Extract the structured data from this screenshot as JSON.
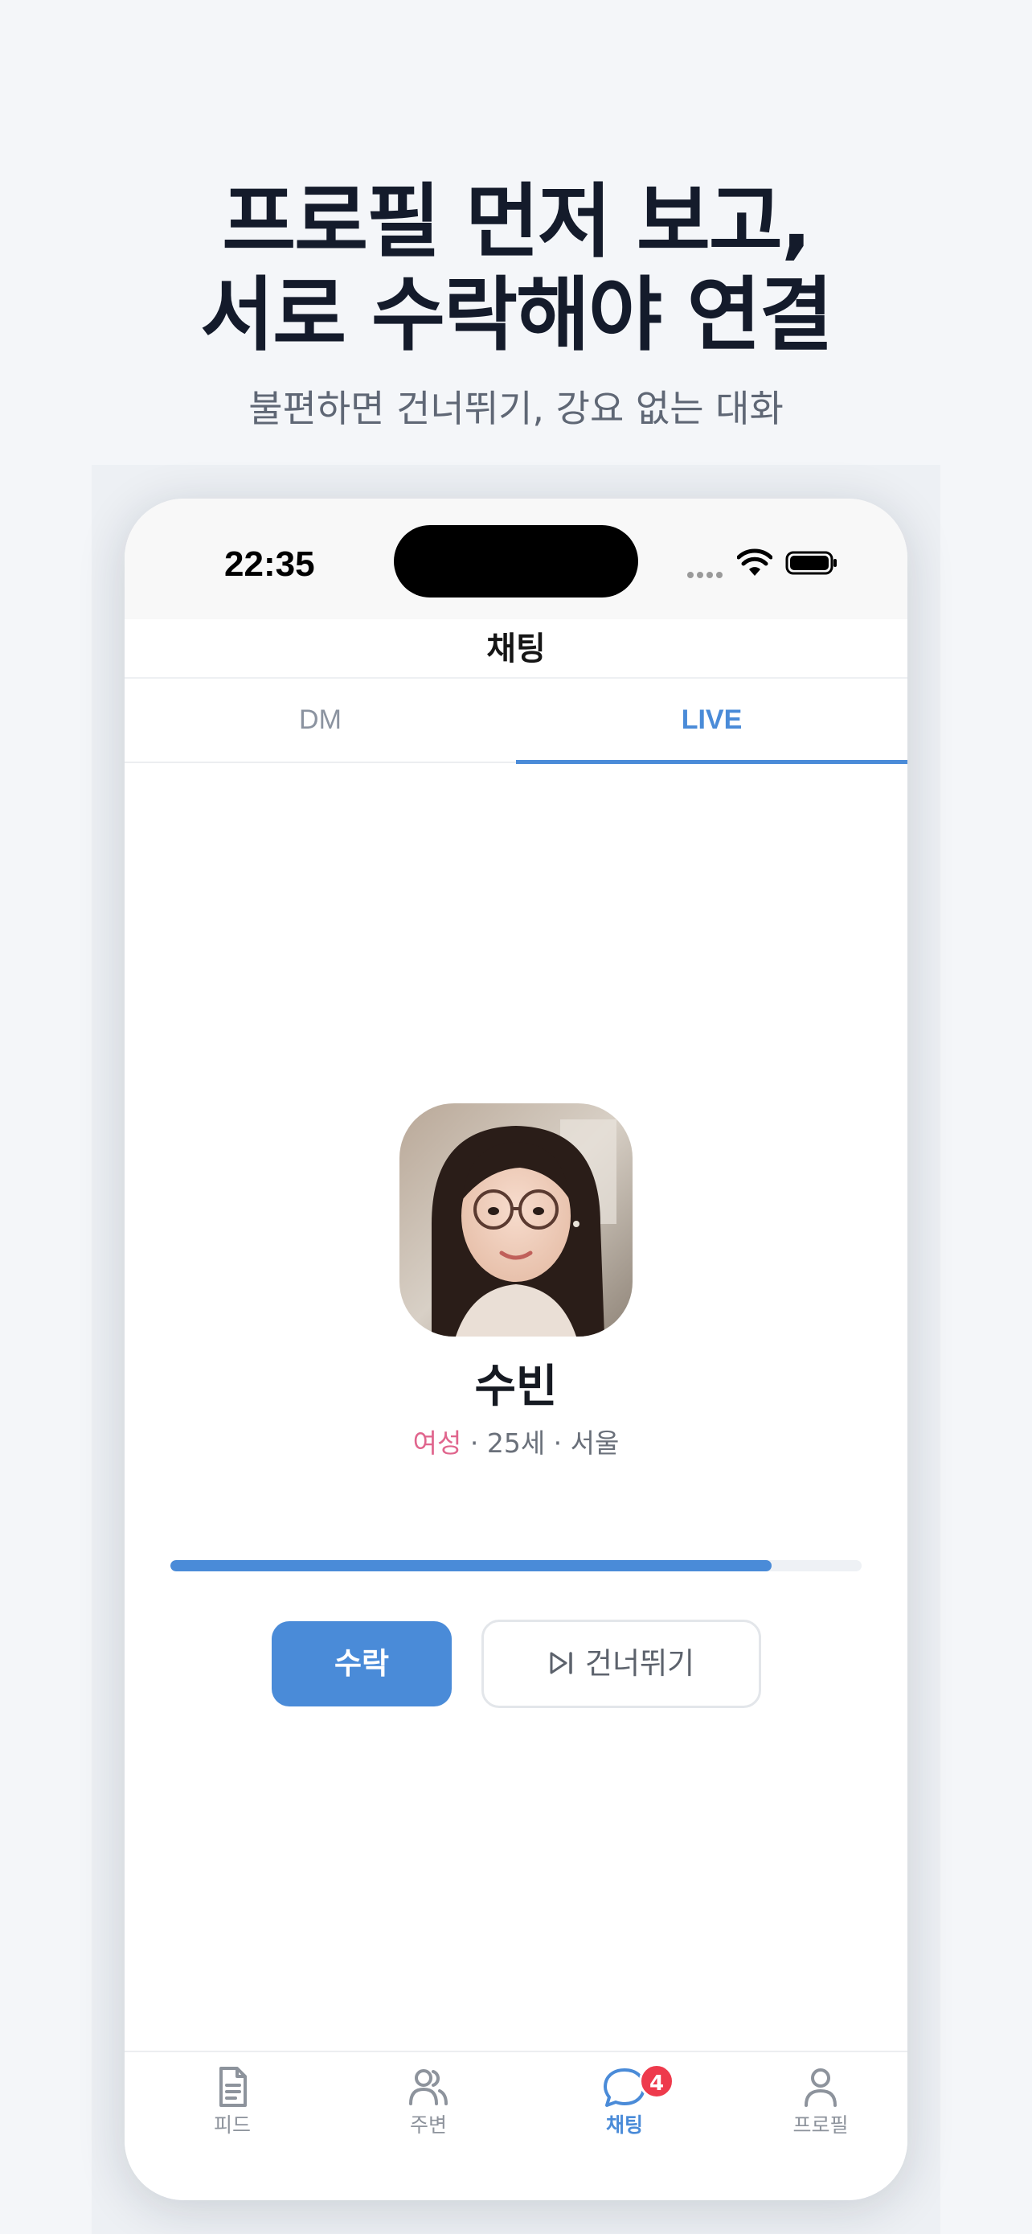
{
  "headline": {
    "line1": "프로필 먼저 보고,",
    "line2": "서로 수락해야 연결"
  },
  "subheadline": "불편하면 건너뛰기, 강요 없는 대화",
  "statusbar": {
    "time": "22:35"
  },
  "screen": {
    "title": "채팅",
    "tabs": [
      {
        "label": "DM",
        "selected": false
      },
      {
        "label": "LIVE",
        "selected": true
      }
    ]
  },
  "profile": {
    "name": "수빈",
    "gender": "여성",
    "details": " · 25세 · 서울",
    "timer_progress": 0.87
  },
  "actions": {
    "accept_label": "수락",
    "skip_label": "건너뛰기"
  },
  "tabbar": [
    {
      "label": "피드",
      "icon": "document-icon"
    },
    {
      "label": "주변",
      "icon": "users-icon"
    },
    {
      "label": "채팅",
      "icon": "chat-bubble-icon",
      "badge": "4",
      "active": true
    },
    {
      "label": "프로필",
      "icon": "person-icon"
    }
  ],
  "colors": {
    "accent": "#4a8bd8",
    "badge": "#ee3a4c",
    "gender": "#e0658d",
    "headline": "#141b2b"
  }
}
